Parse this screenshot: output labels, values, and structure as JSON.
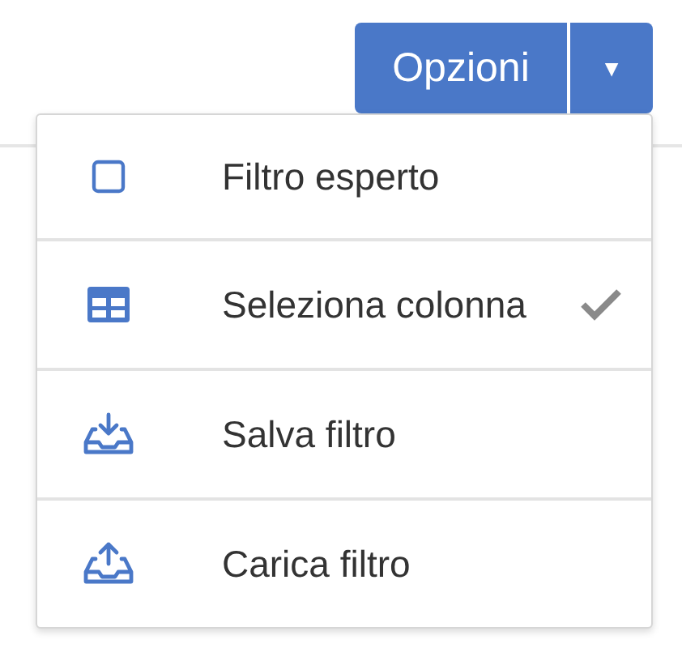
{
  "button": {
    "label": "Opzioni",
    "caret": "▼"
  },
  "menu": [
    {
      "kind": "square",
      "label": "Filtro esperto",
      "checked": false
    },
    {
      "kind": "table",
      "label": "Seleziona colonna",
      "checked": true
    },
    {
      "kind": "download",
      "label": "Salva filtro",
      "checked": false
    },
    {
      "kind": "upload",
      "label": "Carica filtro",
      "checked": false
    }
  ]
}
